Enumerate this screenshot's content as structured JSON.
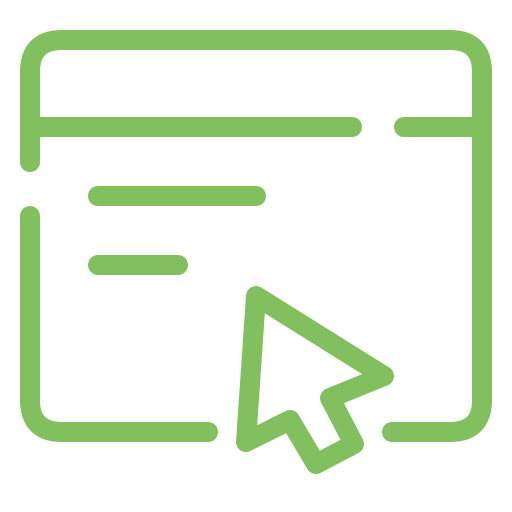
{
  "icon": {
    "name": "browser-window-click-icon",
    "accent_color": "#82bf5e",
    "background_color": "#ffffff",
    "parts": {
      "window": "browser-window-outline",
      "content_lines": 2,
      "cursor": "mouse-pointer-arrow"
    }
  }
}
